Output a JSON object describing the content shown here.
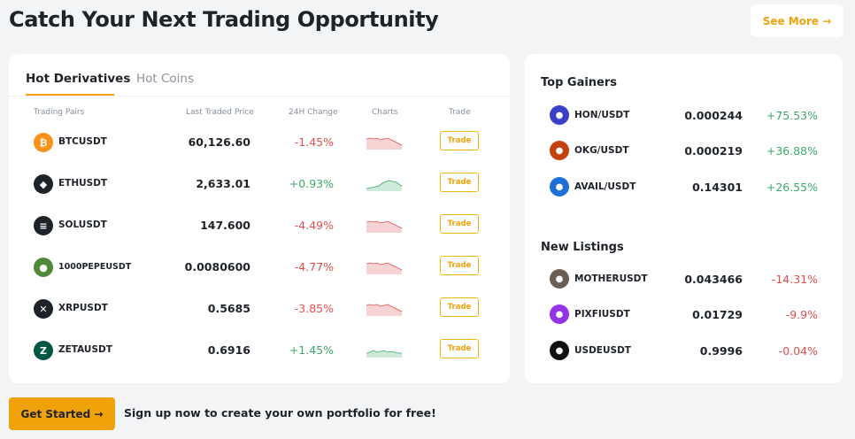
{
  "header": {
    "title": "Catch Your Next Trading Opportunity",
    "see_more": "See More →"
  },
  "derivatives": {
    "tabs": [
      "Hot Derivatives",
      "Hot Coins"
    ],
    "columns": [
      "Trading Pairs",
      "Last Traded Price",
      "24H Change",
      "Charts",
      "Trade"
    ],
    "trade_label": "Trade",
    "rows": [
      {
        "pair": "BTCUSDT",
        "price": "60,126.60",
        "change": "-1.45%",
        "direction": "down",
        "icon": "bitcoin-icon",
        "color": "#f7931a",
        "glyph": "₿"
      },
      {
        "pair": "ETHUSDT",
        "price": "2,633.01",
        "change": "+0.93%",
        "direction": "up",
        "icon": "ethereum-icon",
        "color": "#1e2329",
        "glyph": "◆"
      },
      {
        "pair": "SOLUSDT",
        "price": "147.600",
        "change": "-4.49%",
        "direction": "down",
        "icon": "solana-icon",
        "color": "#1e2329",
        "glyph": "≡"
      },
      {
        "pair": "1000PEPEUSDT",
        "price": "0.0080600",
        "change": "-4.77%",
        "direction": "down",
        "icon": "pepe-icon",
        "color": "#4f8a3a",
        "glyph": "●"
      },
      {
        "pair": "XRPUSDT",
        "price": "0.5685",
        "change": "-3.85%",
        "direction": "down",
        "icon": "xrp-icon",
        "color": "#1e2329",
        "glyph": "✕"
      },
      {
        "pair": "ZETAUSDT",
        "price": "0.6916",
        "change": "+1.45%",
        "direction": "up",
        "icon": "zeta-icon",
        "color": "#005741",
        "glyph": "Z"
      }
    ]
  },
  "top_gainers": {
    "title": "Top Gainers",
    "rows": [
      {
        "pair": "HON/USDT",
        "price": "0.000244",
        "change": "+75.53%",
        "direction": "up",
        "icon": "hon-icon",
        "color": "#3a3fc7"
      },
      {
        "pair": "OKG/USDT",
        "price": "0.000219",
        "change": "+36.88%",
        "direction": "up",
        "icon": "okg-icon",
        "color": "#c2410c"
      },
      {
        "pair": "AVAIL/USDT",
        "price": "0.14301",
        "change": "+26.55%",
        "direction": "up",
        "icon": "avail-icon",
        "color": "#1e6fd9"
      }
    ]
  },
  "new_listings": {
    "title": "New Listings",
    "rows": [
      {
        "pair": "MOTHERUSDT",
        "price": "0.043466",
        "change": "-14.31%",
        "direction": "down",
        "icon": "mother-icon",
        "color": "#6b5e55"
      },
      {
        "pair": "PIXFIUSDT",
        "price": "0.01729",
        "change": "-9.9%",
        "direction": "down",
        "icon": "pixfi-icon",
        "color": "#9333ea"
      },
      {
        "pair": "USDEUSDT",
        "price": "0.9996",
        "change": "-0.04%",
        "direction": "down",
        "icon": "usde-icon",
        "color": "#111111"
      }
    ]
  },
  "footer": {
    "get_started": "Get Started →",
    "signup_text": "Sign up now to create your own portfolio for free!"
  },
  "colors": {
    "accent": "#f0a20b",
    "positive": "#3caa6a",
    "negative": "#e24f4f"
  }
}
